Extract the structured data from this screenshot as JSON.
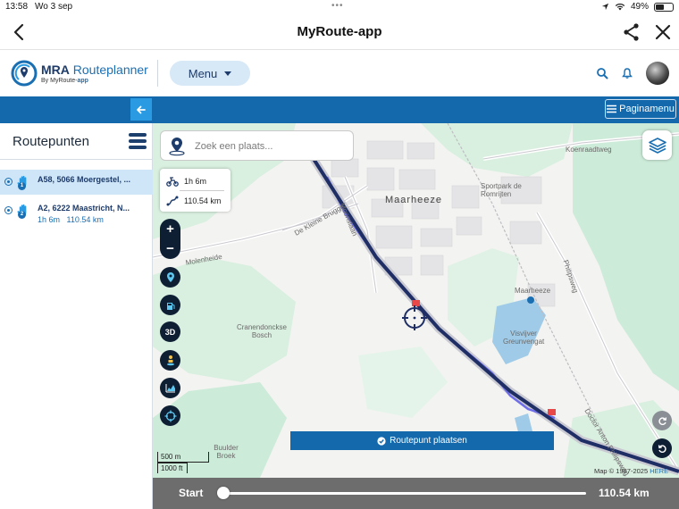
{
  "status_bar": {
    "time": "13:58",
    "date": "Wo 3 sep",
    "battery": "49%",
    "battery_level": 0.49
  },
  "nav": {
    "title": "MyRoute-app",
    "back_icon": "chevron-left-icon",
    "share_icon": "share-icon",
    "close_icon": "close-icon"
  },
  "app_header": {
    "brand_bold": "MRA",
    "brand_rest": " Routeplanner",
    "brand_sub_prefix": "By MyRoute-",
    "brand_sub_app": "app",
    "menu_label": "Menu"
  },
  "toolbar": {
    "page_menu_label": "Paginamenu"
  },
  "sidebar": {
    "title": "Routepunten",
    "items": [
      {
        "number": "1",
        "address": "A58, 5066 Moergestel, ...",
        "duration": "",
        "distance": "",
        "selected": true
      },
      {
        "number": "2",
        "address": "A2, 6222 Maastricht, N...",
        "duration": "1h 6m",
        "distance": "110.54 km",
        "selected": false
      }
    ]
  },
  "map": {
    "search_placeholder": "Zoek een plaats...",
    "info_duration": "1h 6m",
    "info_distance": "110.54 km",
    "zoom_in": "+",
    "zoom_out": "−",
    "mode_3d": "3D",
    "labels": {
      "town": "Maarheeze",
      "koenraadtweg": "Koenraadtweg",
      "sportpark": "Sportpark de Romrijten",
      "moonslaan": "Moonslaan",
      "kleinebrugge": "De Kleine Brugge",
      "molenheide": "Molenheide",
      "station": "Maarheeze",
      "philipsweg": "Philipsweg",
      "visvijver": "Visvijver Greunvengat",
      "bosch": "Cranendonckse Bosch",
      "drphilips": "Doctor Anton Philipsweg",
      "buulder": "Buulder Broek"
    },
    "place_button": "Routepunt plaatsen",
    "scale_metric": "500 m",
    "scale_imperial": "1000 ft",
    "attribution": "Map © 1987-2025 ",
    "attribution_link": "HERE",
    "colors": {
      "route": "#1f2f66",
      "route_alt": "#6f6ee8",
      "park": "#cdebd9",
      "water": "#9fcbe8"
    }
  },
  "slider": {
    "start_label": "Start",
    "end_label": "110.54 km",
    "position": 0
  }
}
